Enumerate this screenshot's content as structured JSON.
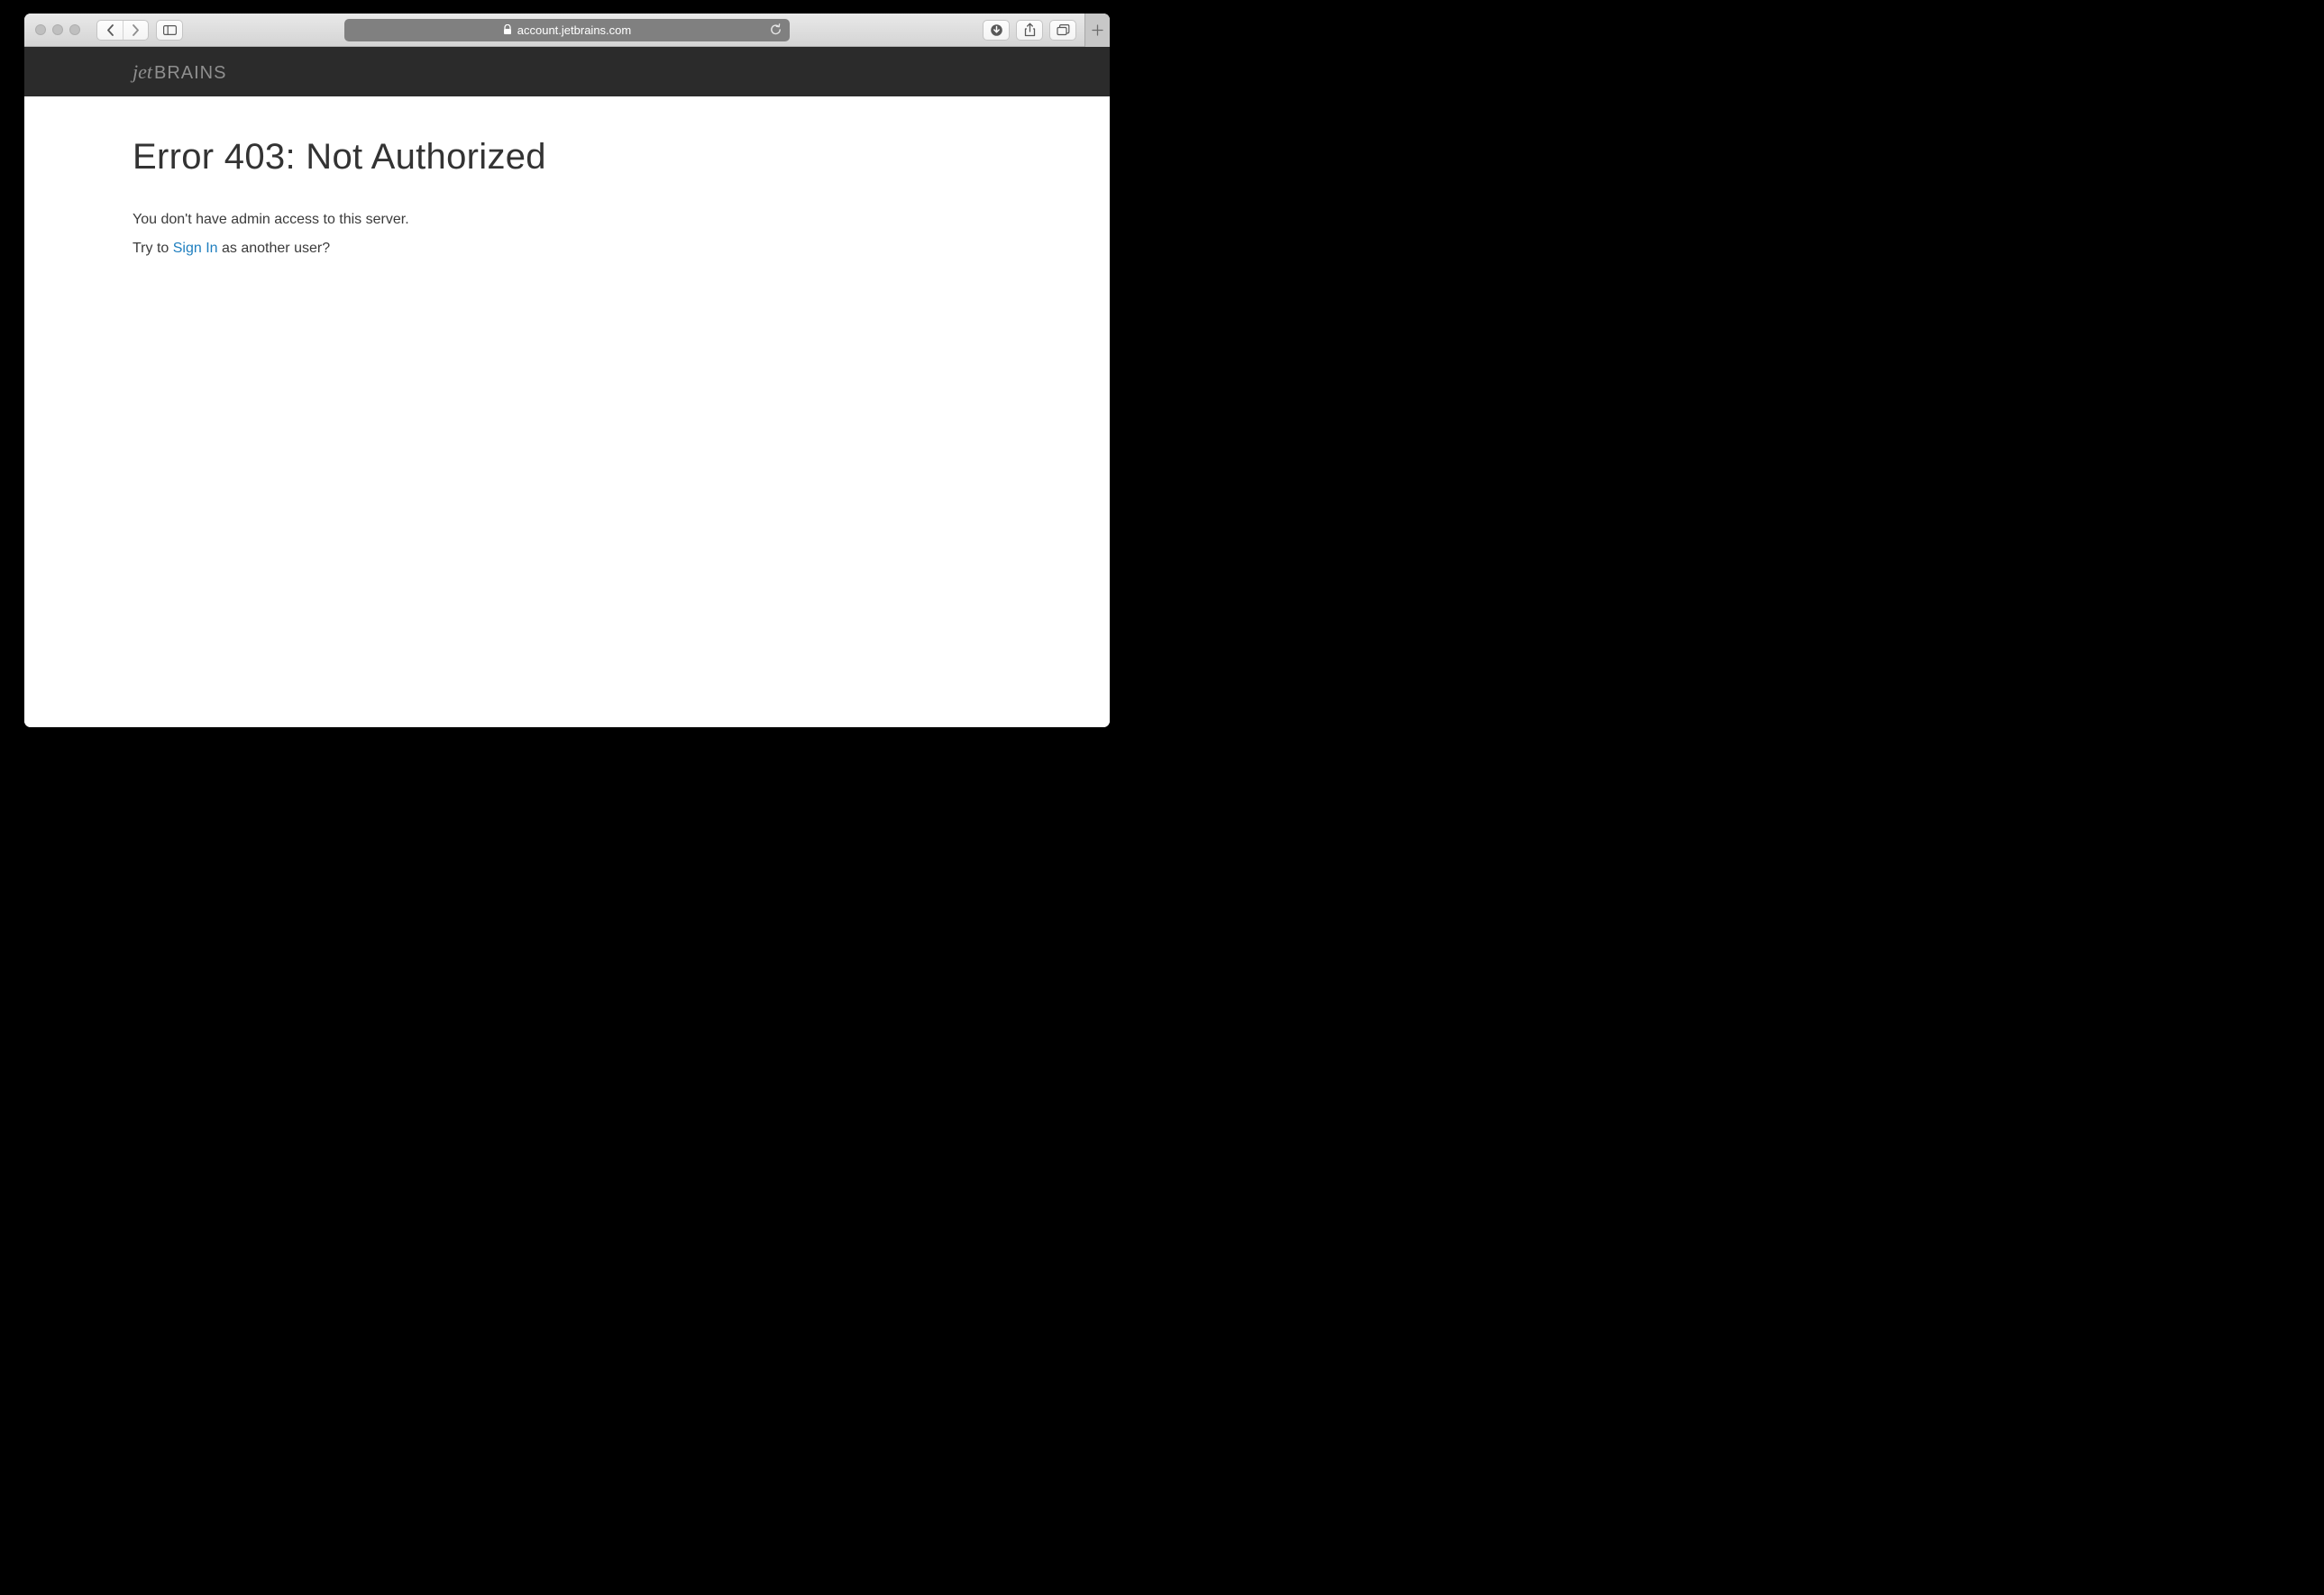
{
  "browser": {
    "url": "account.jetbrains.com"
  },
  "brand": {
    "script": "jet",
    "caps": "BRAINS"
  },
  "error": {
    "title": "Error 403: Not Authorized",
    "message": "You don't have admin access to this server.",
    "try_prefix": "Try to ",
    "signin": "Sign In",
    "try_suffix": " as another user?"
  }
}
